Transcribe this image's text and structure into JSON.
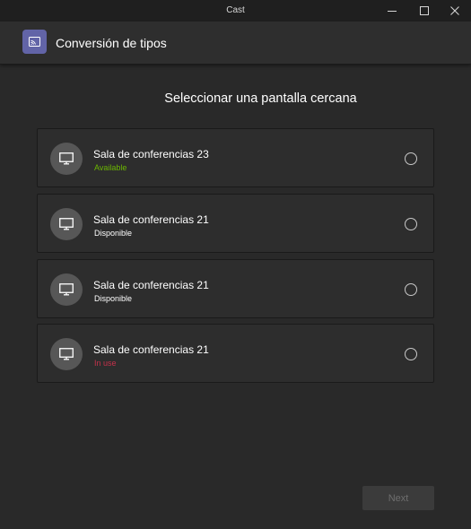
{
  "window": {
    "title": "Cast",
    "controls": [
      {
        "icon": "minimize-icon"
      },
      {
        "icon": "maximize-icon"
      },
      {
        "icon": "close-icon"
      }
    ]
  },
  "header": {
    "app_icon": "cast-icon",
    "app_name": "Conversión de tipos",
    "accent_color": "#6264a7"
  },
  "main": {
    "heading": "Seleccionar una pantalla cercana",
    "devices": [
      {
        "name": "Sala de conferencias 23",
        "status": "Available",
        "status_color": "#6bb700",
        "icon": "monitor-icon"
      },
      {
        "name": "Sala de conferencias 21",
        "status": "Disponible",
        "status_color": "#ffffff",
        "icon": "monitor-icon"
      },
      {
        "name": "Sala de conferencias 21",
        "status": "Disponible",
        "status_color": "#ffffff",
        "icon": "monitor-icon"
      },
      {
        "name": "Sala de conferencias 21",
        "status": "In use",
        "status_color": "#c4314b",
        "icon": "monitor-icon"
      }
    ]
  },
  "footer": {
    "next_label": "Next"
  }
}
